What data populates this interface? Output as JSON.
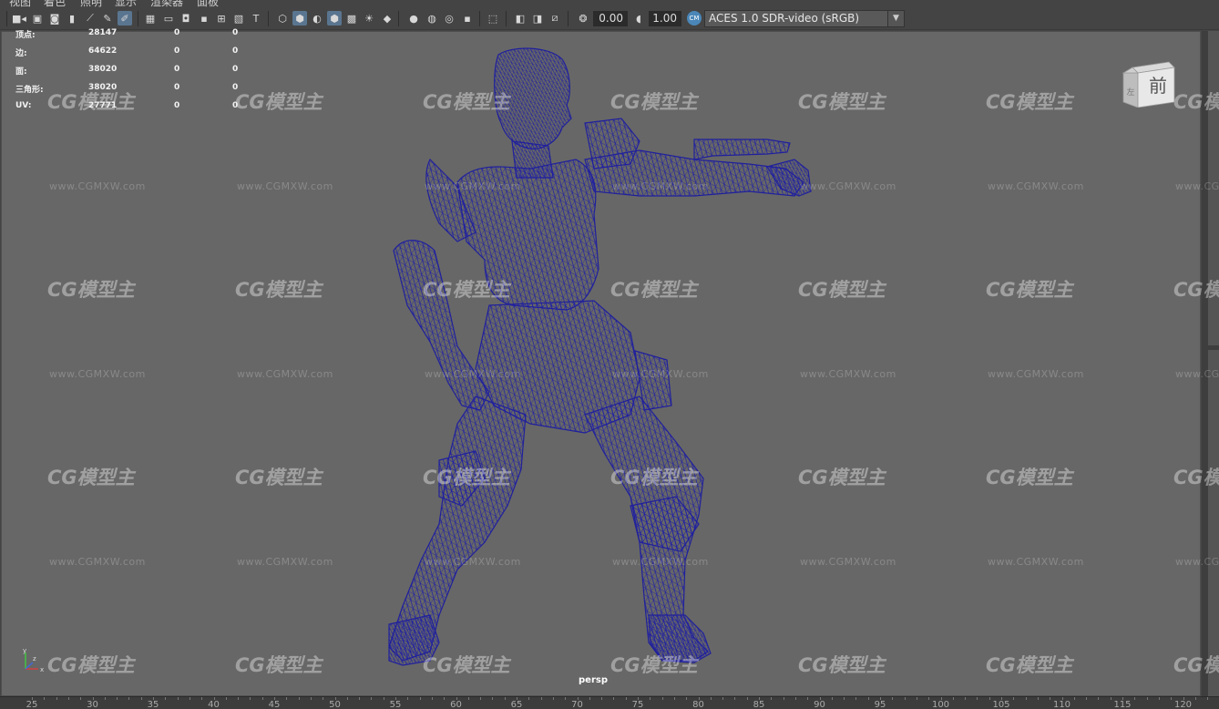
{
  "menus": [
    "视图",
    "着色",
    "照明",
    "显示",
    "渲染器",
    "面板"
  ],
  "toolbar": {
    "near_clip": "0.00",
    "exposure": "1.00",
    "color_management": "ACES 1.0 SDR-video (sRGB)"
  },
  "hud": {
    "rows": [
      {
        "label": "顶点:",
        "v1": "28147",
        "v2": "0",
        "v3": "0"
      },
      {
        "label": "边:",
        "v1": "64622",
        "v2": "0",
        "v3": "0"
      },
      {
        "label": "面:",
        "v1": "38020",
        "v2": "0",
        "v3": "0"
      },
      {
        "label": "三角形:",
        "v1": "38020",
        "v2": "0",
        "v3": "0"
      },
      {
        "label": "UV:",
        "v1": "27771",
        "v2": "0",
        "v3": "0"
      }
    ]
  },
  "viewcube": {
    "front": "前",
    "left": "左"
  },
  "camera_label": "persp",
  "watermark": {
    "logo": "CG模型主",
    "url": "www.CGMXW.com"
  },
  "axis": {
    "x": "x",
    "y": "y",
    "z": "z"
  },
  "ruler": [
    "25",
    "30",
    "35",
    "40",
    "45",
    "50",
    "55",
    "60",
    "65",
    "70",
    "75",
    "80",
    "85",
    "90",
    "95",
    "100",
    "105",
    "110",
    "115",
    "120"
  ],
  "colors": {
    "viewport": "#676767",
    "wireframe": "#1a1aa0",
    "toolbar": "#444444"
  }
}
